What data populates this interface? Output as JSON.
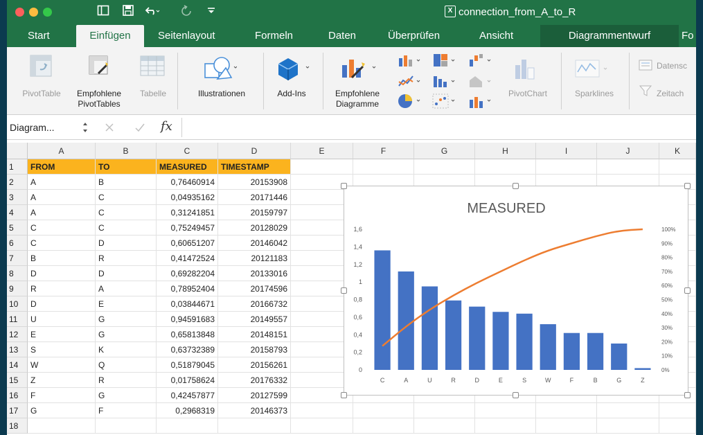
{
  "titlebar": {
    "document_title": "connection_from_A_to_R",
    "colors": {
      "accent": "#217346",
      "close": "#fc605c",
      "minimize": "#fdbc40",
      "maximize": "#34c84a"
    }
  },
  "tabs": [
    {
      "label": "Start"
    },
    {
      "label": "Einfügen"
    },
    {
      "label": "Seitenlayout"
    },
    {
      "label": "Formeln"
    },
    {
      "label": "Daten"
    },
    {
      "label": "Überprüfen"
    },
    {
      "label": "Ansicht"
    },
    {
      "label": "Diagrammentwurf"
    },
    {
      "label": "Fo"
    }
  ],
  "ribbon": {
    "pivottable": "PivotTable",
    "empfohlene_pivottables_1": "Empfohlene",
    "empfohlene_pivottables_2": "PivotTables",
    "tabelle": "Tabelle",
    "illustrationen": "Illustrationen",
    "addins": "Add-Ins",
    "empfohlene_diagramme_1": "Empfohlene",
    "empfohlene_diagramme_2": "Diagramme",
    "pivotchart": "PivotChart",
    "sparklines": "Sparklines",
    "datenschnitt": "Datensc",
    "zeitachse": "Zeitach"
  },
  "formula_bar": {
    "name_box": "Diagram...",
    "fx": "fx"
  },
  "columns": [
    "A",
    "B",
    "C",
    "D",
    "E",
    "F",
    "G",
    "H",
    "I",
    "J",
    "K"
  ],
  "rows": [
    "1",
    "2",
    "3",
    "4",
    "5",
    "6",
    "7",
    "8",
    "9",
    "10",
    "11",
    "12",
    "13",
    "14",
    "15",
    "16",
    "17",
    "18"
  ],
  "table": {
    "headers": [
      "FROM",
      "TO",
      "MEASURED",
      "TIMESTAMP"
    ],
    "data": [
      [
        "A",
        "B",
        "0,76460914",
        "20153908"
      ],
      [
        "A",
        "C",
        "0,04935162",
        "20171446"
      ],
      [
        "A",
        "C",
        "0,31241851",
        "20159797"
      ],
      [
        "C",
        "C",
        "0,75249457",
        "20128029"
      ],
      [
        "C",
        "D",
        "0,60651207",
        "20146042"
      ],
      [
        "B",
        "R",
        "0,41472524",
        "20121183"
      ],
      [
        "D",
        "D",
        "0,69282204",
        "20133016"
      ],
      [
        "R",
        "A",
        "0,78952404",
        "20174596"
      ],
      [
        "D",
        "E",
        "0,03844671",
        "20166732"
      ],
      [
        "U",
        "G",
        "0,94591683",
        "20149557"
      ],
      [
        "E",
        "G",
        "0,65813848",
        "20148151"
      ],
      [
        "S",
        "K",
        "0,63732389",
        "20158793"
      ],
      [
        "W",
        "Q",
        "0,51879045",
        "20156261"
      ],
      [
        "Z",
        "R",
        "0,01758624",
        "20176332"
      ],
      [
        "F",
        "G",
        "0,42457877",
        "20127599"
      ],
      [
        "G",
        "F",
        "0,2968319",
        "20146373"
      ]
    ]
  },
  "chart_data": {
    "type": "bar",
    "title": "MEASURED",
    "categories": [
      "C",
      "A",
      "U",
      "R",
      "D",
      "E",
      "S",
      "W",
      "F",
      "B",
      "G",
      "Z"
    ],
    "values": [
      1.36,
      1.12,
      0.95,
      0.79,
      0.72,
      0.66,
      0.64,
      0.52,
      0.42,
      0.42,
      0.3,
      0.02
    ],
    "ylim": [
      0,
      1.6
    ],
    "yticks": [
      "0",
      "0,2",
      "0,4",
      "0,6",
      "0,8",
      "1",
      "1,2",
      "1,4",
      "1,6"
    ],
    "y2ticks": [
      "0%",
      "10%",
      "20%",
      "30%",
      "40%",
      "50%",
      "60%",
      "70%",
      "80%",
      "90%",
      "100%"
    ],
    "cumulative_percent": [
      17,
      31,
      43,
      53,
      62,
      70,
      78,
      85,
      90,
      95,
      99,
      100
    ],
    "bar_color": "#4472c4",
    "line_color": "#ed7d31",
    "grid": false,
    "legend": "none"
  }
}
